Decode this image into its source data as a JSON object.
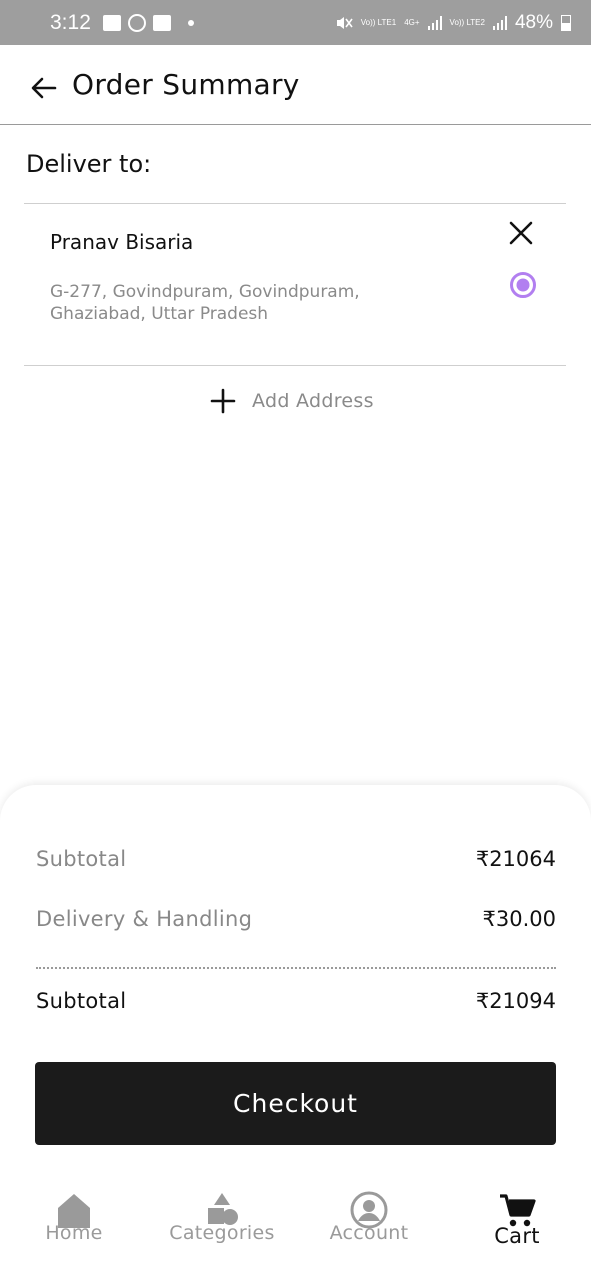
{
  "status_bar": {
    "time": "3:12",
    "sim1_label": "Vo)) LTE1",
    "network_type": "4G+",
    "sim2_label": "Vo)) LTE2",
    "battery": "48%"
  },
  "header": {
    "title": "Order Summary",
    "back_icon": "arrow-left-icon"
  },
  "delivery": {
    "label": "Deliver to:",
    "address": {
      "name": "Pranav Bisaria",
      "line1": "G-277, Govindpuram, Govindpuram,",
      "line2": "Ghaziabad, Uttar Pradesh",
      "selected": true
    },
    "add_address_label": "Add Address"
  },
  "summary": {
    "subtotal_label": "Subtotal",
    "subtotal_value": "₹21064",
    "delivery_label": "Delivery & Handling",
    "delivery_value": "₹30.00",
    "total_label": "Subtotal",
    "total_value": "₹21094",
    "checkout_label": "Checkout"
  },
  "nav": {
    "items": [
      {
        "label": "Home",
        "icon": "home-icon",
        "active": false
      },
      {
        "label": "Categories",
        "icon": "categories-icon",
        "active": false
      },
      {
        "label": "Account",
        "icon": "account-icon",
        "active": false
      },
      {
        "label": "Cart",
        "icon": "cart-icon",
        "active": true
      }
    ]
  },
  "colors": {
    "accent_radio": "#b27ff0",
    "button_bg": "#1b1b1b",
    "status_bar_bg": "#9e9e9e"
  }
}
